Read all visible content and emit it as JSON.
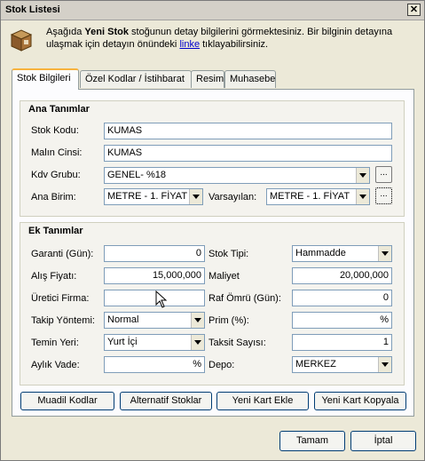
{
  "window": {
    "title": "Stok Listesi"
  },
  "info": {
    "text_1": "Aşağıda ",
    "bold": "Yeni Stok",
    "text_2": " stoğunun detay bilgilerini görmektesiniz. Bir bilginin detayına ulaşmak için detayın önündeki ",
    "link": "linke",
    "text_3": " tıklayabilirsiniz."
  },
  "tabs": [
    "Stok Bilgileri",
    "Özel Kodlar / İstihbarat",
    "Resim",
    "Muhasebe"
  ],
  "ana": {
    "title": "Ana Tanımlar",
    "stok_kodu_label": "Stok Kodu:",
    "stok_kodu_value": "KUMAS",
    "malin_cinsi_label": "Malın Cinsi:",
    "malin_cinsi_value": "KUMAS",
    "kdv_grubu_label": "Kdv Grubu:",
    "kdv_grubu_value": "GENEL- %18",
    "ana_birim_label": "Ana Birim:",
    "ana_birim_value": "METRE - 1. FİYAT",
    "varsayilan_label": "Varsayılan:",
    "varsayilan_value": "METRE - 1. FİYAT"
  },
  "ek": {
    "title": "Ek Tanımlar",
    "garanti_label": "Garanti (Gün):",
    "garanti_value": "0",
    "stok_tipi_label": "Stok Tipi:",
    "stok_tipi_value": "Hammadde",
    "alis_fiyati_label": "Alış Fiyatı:",
    "alis_fiyati_value": "15,000,000",
    "maliyet_label": "Maliyet",
    "maliyet_value": "20,000,000",
    "uretici_label": "Üretici Firma:",
    "uretici_value": "",
    "raf_omru_label": "Raf Ömrü (Gün):",
    "raf_omru_value": "0",
    "takip_label": "Takip Yöntemi:",
    "takip_value": "Normal",
    "prim_label": "Prim (%):",
    "prim_value": "%",
    "temin_label": "Temin Yeri:",
    "temin_value": "Yurt İçi",
    "taksit_label": "Taksit Sayısı:",
    "taksit_value": "1",
    "vade_label": "Aylık Vade:",
    "vade_value": "%",
    "depo_label": "Depo:",
    "depo_value": "MERKEZ"
  },
  "buttons": {
    "muadil": "Muadil Kodlar",
    "alternatif": "Alternatif Stoklar",
    "yeni_kart": "Yeni Kart Ekle",
    "kopyala": "Yeni Kart Kopyala",
    "tamam": "Tamam",
    "iptal": "İptal",
    "ellipsis": "..."
  },
  "colors": {
    "link": "#0000cc",
    "tab_highlight": "#f7b33e",
    "field_border": "#7f9db9"
  }
}
